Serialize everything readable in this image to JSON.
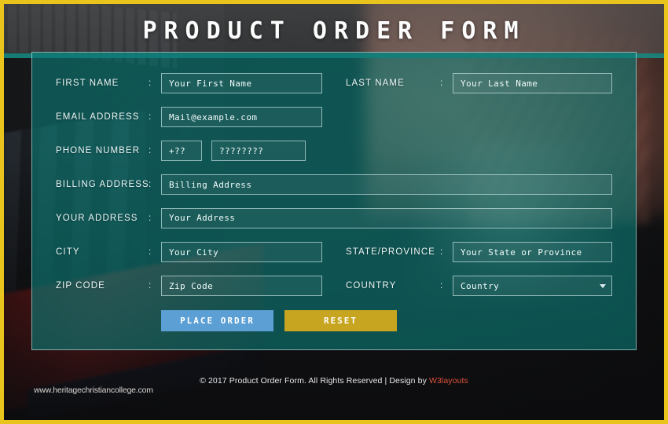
{
  "page": {
    "title": "PRODUCT ORDER FORM",
    "frame_color": "#e8c41c",
    "panel_color": "#0c7a76"
  },
  "form": {
    "fields": {
      "first_name": {
        "label": "FIRST NAME",
        "colon": ":",
        "placeholder": "Your First Name"
      },
      "last_name": {
        "label": "LAST NAME",
        "colon": ":",
        "placeholder": "Your Last Name"
      },
      "email": {
        "label": "EMAIL ADDRESS",
        "colon": ":",
        "placeholder": "Mail@example.com"
      },
      "phone": {
        "label": "PHONE NUMBER",
        "colon": ":",
        "country_code_placeholder": "+??",
        "number_placeholder": "????????"
      },
      "billing": {
        "label": "BILLING ADDRESS",
        "colon": ":",
        "placeholder": "Billing Address"
      },
      "address": {
        "label": "YOUR ADDRESS",
        "colon": ":",
        "placeholder": "Your Address"
      },
      "city": {
        "label": "CITY",
        "colon": ":",
        "placeholder": "Your City"
      },
      "state": {
        "label": "STATE/PROVINCE",
        "colon": ":",
        "placeholder": "Your State or Province"
      },
      "zip": {
        "label": "ZIP CODE",
        "colon": ":",
        "placeholder": "Zip Code"
      },
      "country": {
        "label": "COUNTRY",
        "colon": ":",
        "selected": "Country",
        "icon": "chevron-down-icon"
      }
    },
    "buttons": {
      "submit": {
        "label": "PLACE ORDER",
        "color": "#5b9fd4"
      },
      "reset": {
        "label": "RESET",
        "color": "#c7a521"
      }
    }
  },
  "footer": {
    "text": "© 2017 Product Order Form. All Rights Reserved | Design by ",
    "link": "W3layouts",
    "link_color": "#e0523a",
    "watermark": "www.heritagechristiancollege.com"
  }
}
